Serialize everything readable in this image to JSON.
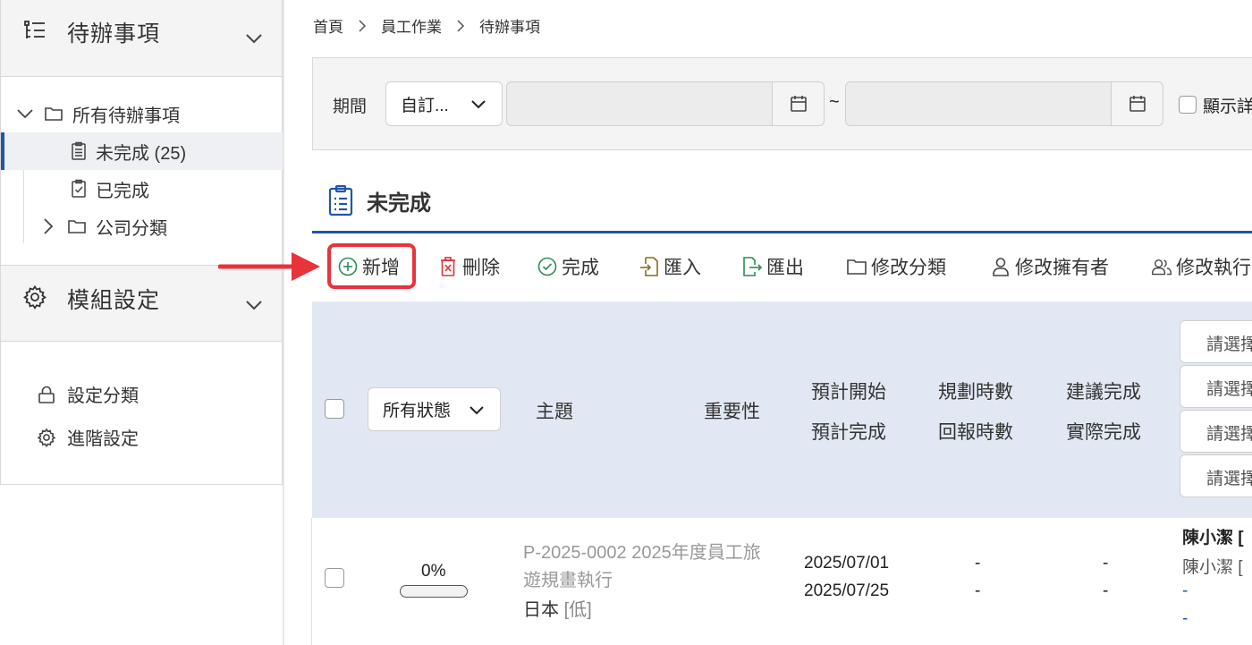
{
  "sidebar": {
    "todo_title": "待辦事項",
    "tree": {
      "all": "所有待辦事項",
      "incomplete": "未完成 (25)",
      "done": "已完成",
      "category": "公司分類"
    },
    "module_title": "模組設定",
    "module_items": {
      "category_settings": "設定分類",
      "advanced_settings": "進階設定"
    }
  },
  "breadcrumb": [
    "首頁",
    "員工作業",
    "待辦事項"
  ],
  "filter": {
    "period_label": "期間",
    "period_value": "自訂...",
    "tilde": "~",
    "show_detail": "顯示詳"
  },
  "section": {
    "title": "未完成"
  },
  "toolbar": {
    "add": "新增",
    "delete": "刪除",
    "complete": "完成",
    "import": "匯入",
    "export": "匯出",
    "change_category": "修改分類",
    "change_owner": "修改擁有者",
    "change_executor": "修改執行"
  },
  "table": {
    "status_filter": "所有狀態",
    "headers": {
      "subject": "主題",
      "importance": "重要性",
      "plan_start": "預計開始",
      "plan_end": "預計完成",
      "plan_hours": "規劃時數",
      "report_hours": "回報時數",
      "suggest_done": "建議完成",
      "actual_done": "實際完成"
    },
    "pickers": [
      "請選擇",
      "請選擇",
      "請選擇",
      "請選擇"
    ],
    "rows": [
      {
        "progress_text": "0%",
        "progress": 0,
        "subject_line1": "P-2025-0002 2025年度員工旅",
        "subject_line2": "遊規畫執行",
        "location": "日本",
        "importance": "[低]",
        "plan_start": "2025/07/01",
        "plan_end": "2025/07/25",
        "plan_hours": "-",
        "report_hours": "-",
        "suggest_done": "-",
        "actual_done": "-",
        "owner": "陳小潔 [",
        "executor": "陳小潔 [",
        "link1": "-",
        "link2": "-"
      }
    ]
  },
  "colors": {
    "accent": "#2255aa",
    "highlight": "#e8333b",
    "header_bg": "#e2e8f3",
    "panel_bg": "#f4f4f4"
  }
}
